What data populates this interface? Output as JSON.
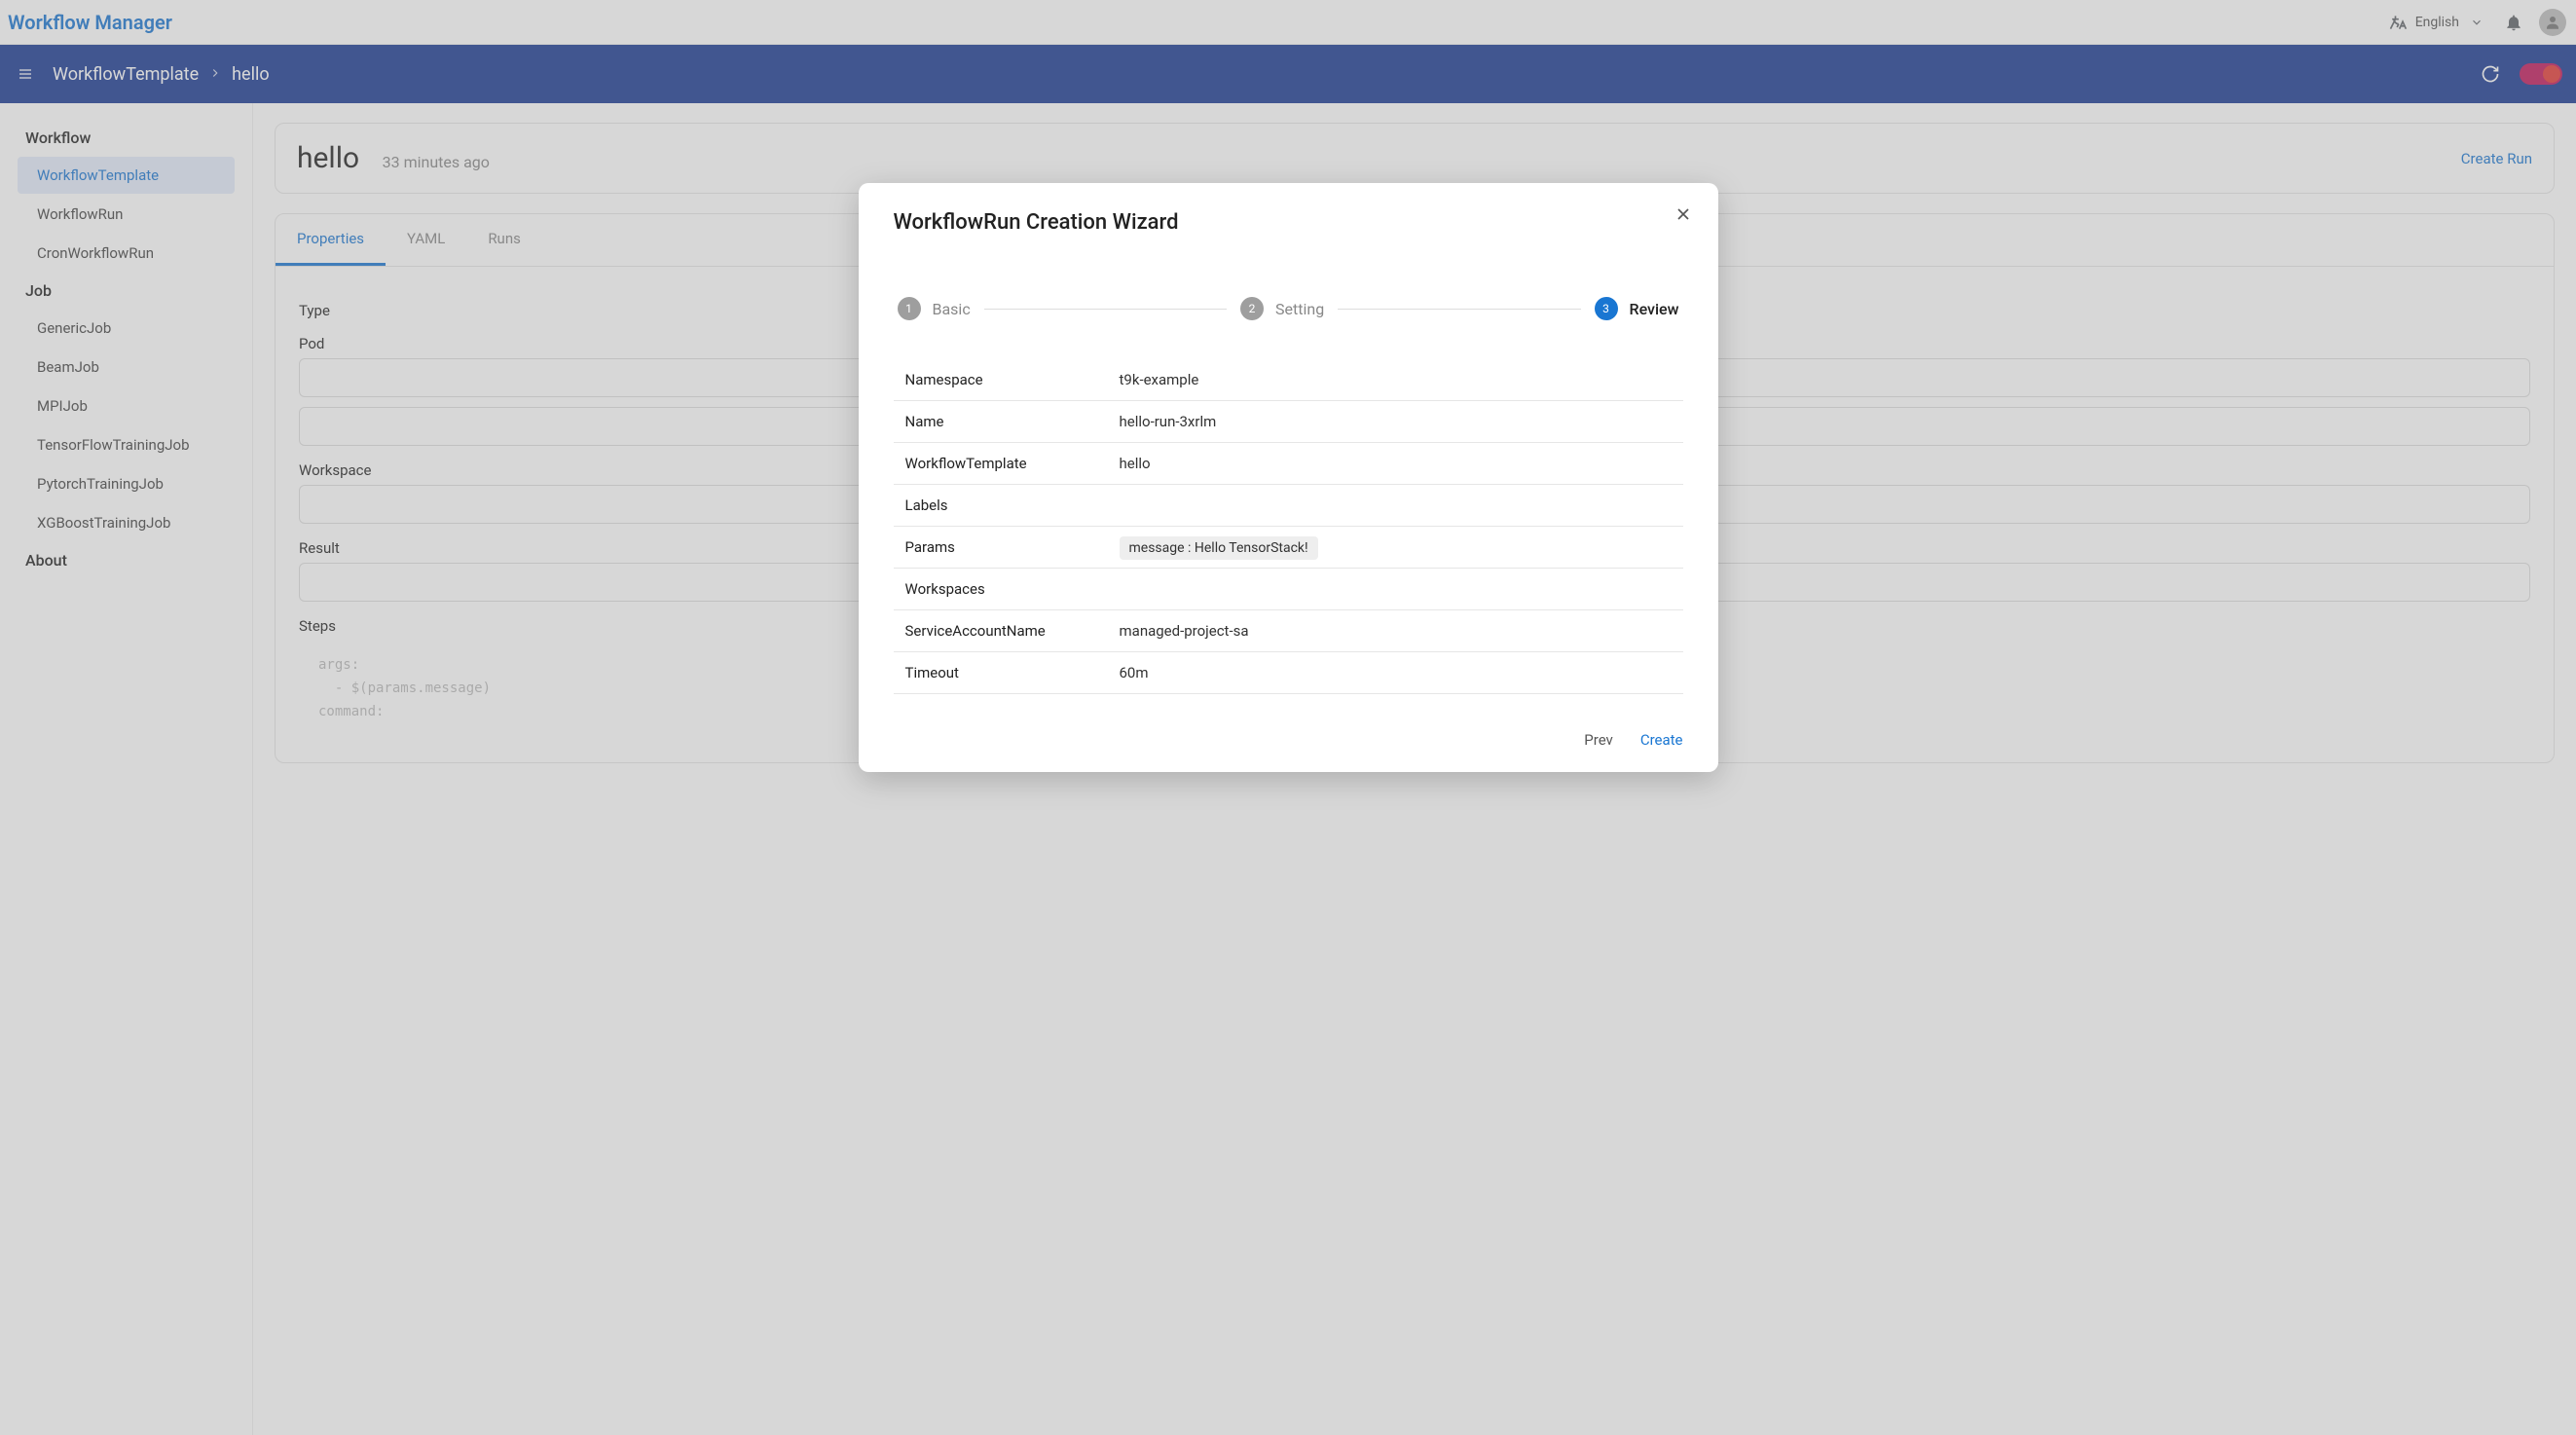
{
  "header": {
    "app_title": "Workflow Manager",
    "language": "English"
  },
  "breadcrumb": {
    "parent": "WorkflowTemplate",
    "current": "hello"
  },
  "sidebar": {
    "group1_title": "Workflow",
    "group1_items": [
      "WorkflowTemplate",
      "WorkflowRun",
      "CronWorkflowRun"
    ],
    "group2_title": "Job",
    "group2_items": [
      "GenericJob",
      "BeamJob",
      "MPIJob",
      "TensorFlowTrainingJob",
      "PytorchTrainingJob",
      "XGBoostTrainingJob"
    ],
    "about": "About"
  },
  "page": {
    "title": "hello",
    "time": "33 minutes ago",
    "create_run": "Create Run"
  },
  "tabs": {
    "properties": "Properties",
    "yaml": "YAML",
    "runs": "Runs"
  },
  "props": {
    "type_key": "Type",
    "pod_key": "Pod",
    "workspace_key": "Workspace",
    "result_key": "Result",
    "steps_key": "Steps",
    "code": "args:\n  - $(params.message)\ncommand:"
  },
  "modal": {
    "title": "WorkflowRun Creation Wizard",
    "steps": {
      "s1": "Basic",
      "s2": "Setting",
      "s3": "Review"
    },
    "rows": {
      "namespace_k": "Namespace",
      "namespace_v": "t9k-example",
      "name_k": "Name",
      "name_v": "hello-run-3xrlm",
      "wft_k": "WorkflowTemplate",
      "wft_v": "hello",
      "labels_k": "Labels",
      "labels_v": "",
      "params_k": "Params",
      "params_chip": "message : Hello TensorStack!",
      "workspaces_k": "Workspaces",
      "workspaces_v": "",
      "san_k": "ServiceAccountName",
      "san_v": "managed-project-sa",
      "timeout_k": "Timeout",
      "timeout_v": "60m"
    },
    "prev": "Prev",
    "create": "Create"
  }
}
